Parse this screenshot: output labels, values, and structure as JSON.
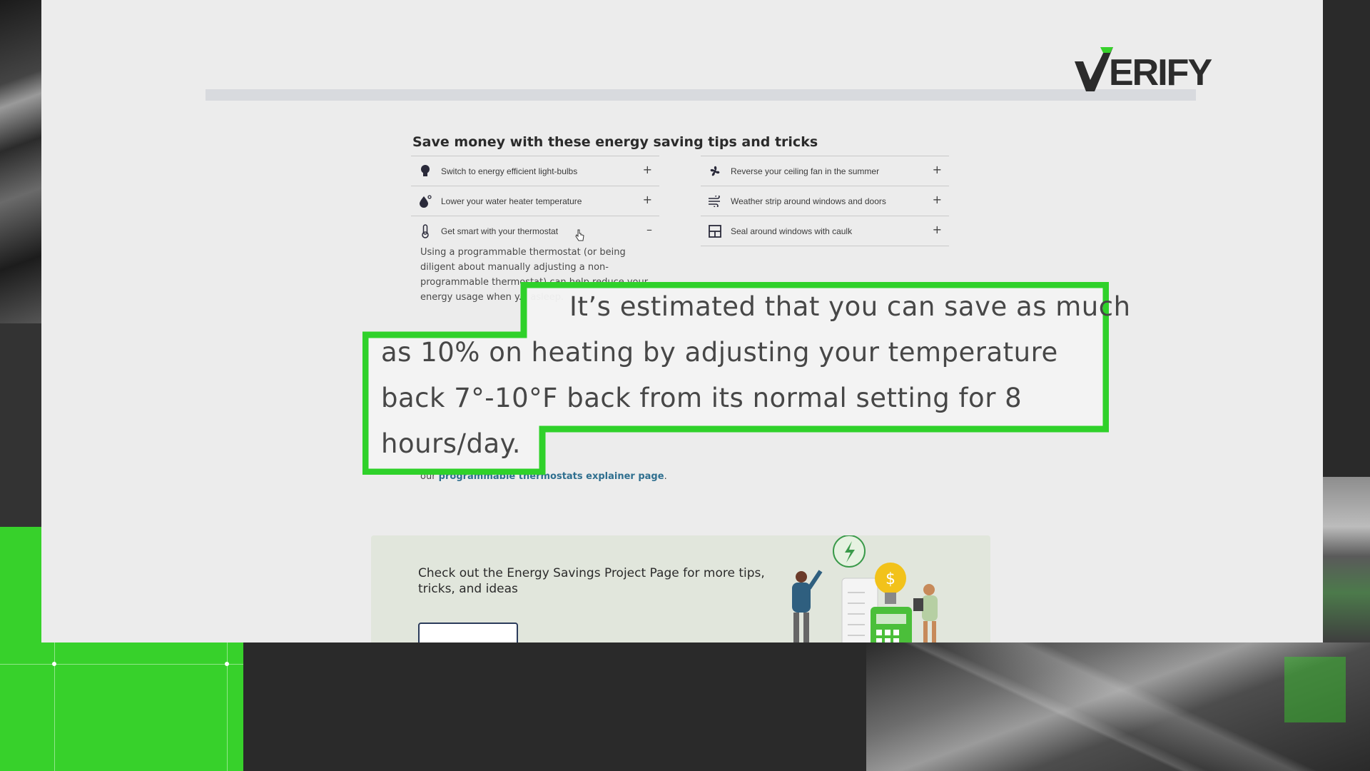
{
  "brand": {
    "logo_text": "ERIFY"
  },
  "page": {
    "heading": "Save money with these energy saving tips and tricks",
    "tips_left": [
      {
        "label": "Switch to energy efficient light-bulbs",
        "toggle": "+",
        "icon": "lightbulb-icon"
      },
      {
        "label": "Lower your water heater temperature",
        "toggle": "+",
        "icon": "water-drop-icon"
      },
      {
        "label": "Get smart with your thermostat",
        "toggle": "–",
        "icon": "thermometer-icon"
      }
    ],
    "tips_right": [
      {
        "label": "Reverse your ceiling fan in the summer",
        "toggle": "+",
        "icon": "fan-icon"
      },
      {
        "label": "Weather strip around windows and doors",
        "toggle": "+",
        "icon": "wind-icon"
      },
      {
        "label": "Seal around windows with caulk",
        "toggle": "+",
        "icon": "window-icon"
      }
    ],
    "expanded_body": "Using a programmable thermostat (or being diligent about manually adjusting a non-programmable thermostat) can help reduce your energy usage when y... asleep.",
    "explainer_prefix": "our ",
    "explainer_link": "programmable thermostats explainer page",
    "explainer_suffix": "."
  },
  "quote": {
    "line1": "It’s estimated that you can save as much",
    "line2": "as 10% on heating by adjusting your temperature",
    "line3": "back 7°-10°F back from its normal setting for 8",
    "line4": "hours/day."
  },
  "promo": {
    "text": "Check out the Energy Savings Project Page for more tips, tricks, and ideas"
  },
  "colors": {
    "highlight": "#2fd12a",
    "accent_green": "#37d12b",
    "link": "#2f6f8f"
  }
}
